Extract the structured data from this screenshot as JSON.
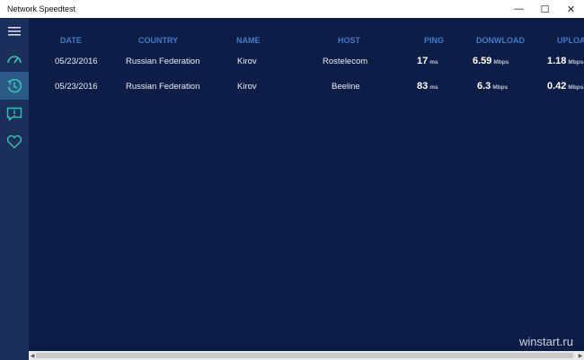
{
  "window": {
    "title": "Network Speedtest",
    "minimize": "—",
    "maximize": "☐",
    "close": "✕"
  },
  "sidebar": {
    "items": [
      {
        "icon": "hamburger-menu-icon"
      },
      {
        "icon": "speedometer-icon"
      },
      {
        "icon": "history-clock-icon",
        "active": true
      },
      {
        "icon": "feedback-icon"
      },
      {
        "icon": "heart-icon"
      }
    ]
  },
  "table": {
    "headers": [
      "DATE",
      "COUNTRY",
      "NAME",
      "HOST",
      "PING",
      "DONWLOAD",
      "UPLOAD"
    ],
    "rows": [
      {
        "date": "05/23/2016",
        "country": "Russian Federation",
        "name": "Kirov",
        "host": "Rostelecom",
        "ping": "17",
        "ping_unit": "ms",
        "download": "6.59",
        "download_unit": "Mbps",
        "upload": "1.18",
        "upload_unit": "Mbps"
      },
      {
        "date": "05/23/2016",
        "country": "Russian Federation",
        "name": "Kirov",
        "host": "Beeline",
        "ping": "83",
        "ping_unit": "ms",
        "download": "6.3",
        "download_unit": "Mbps",
        "upload": "0.42",
        "upload_unit": "Mbps"
      }
    ]
  },
  "watermark": "winstart.ru",
  "colors": {
    "background": "#0e1d45",
    "sidebar": "#1a2f5a",
    "active": "#2c5a86",
    "header_text": "#3f7bc9",
    "accent_icon": "#36c3b8"
  }
}
